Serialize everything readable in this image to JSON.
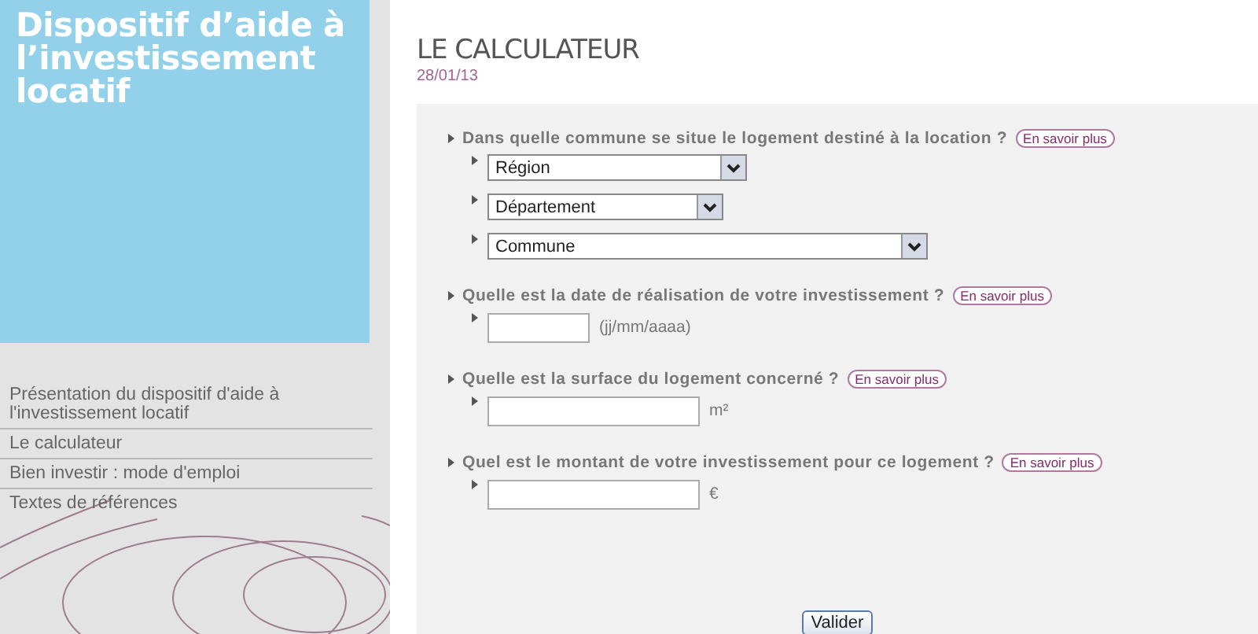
{
  "sidebar": {
    "title": "Dispositif d’aide à l’investissement locatif",
    "items": [
      {
        "label": "Présentation du dispositif d'aide à l'investissement locatif"
      },
      {
        "label": "Le calculateur"
      },
      {
        "label": "Bien investir : mode d'emploi"
      },
      {
        "label": "Textes de références"
      }
    ]
  },
  "page": {
    "title": "LE CALCULATEUR",
    "date": "28/01/13"
  },
  "questions": [
    {
      "label": "Dans quelle commune se situe le logement destiné à la location ?",
      "link": "En savoir plus",
      "fields": [
        {
          "kind": "select",
          "value": "Région"
        },
        {
          "kind": "select",
          "value": "Département"
        },
        {
          "kind": "select",
          "value": "Commune"
        }
      ]
    },
    {
      "label": "Quelle est la date de réalisation de votre investissement ?",
      "link": "En savoir plus",
      "fields": [
        {
          "kind": "text",
          "unit": "(jj/mm/aaaa)"
        }
      ]
    },
    {
      "label": "Quelle est la surface du logement concerné ?",
      "link": "En savoir plus",
      "fields": [
        {
          "kind": "text",
          "unit": "m²"
        }
      ]
    },
    {
      "label": "Quel est le montant de votre investissement pour ce logement ?",
      "link": "En savoir plus",
      "fields": [
        {
          "kind": "text",
          "unit": "€"
        }
      ]
    }
  ],
  "submit": "Valider"
}
